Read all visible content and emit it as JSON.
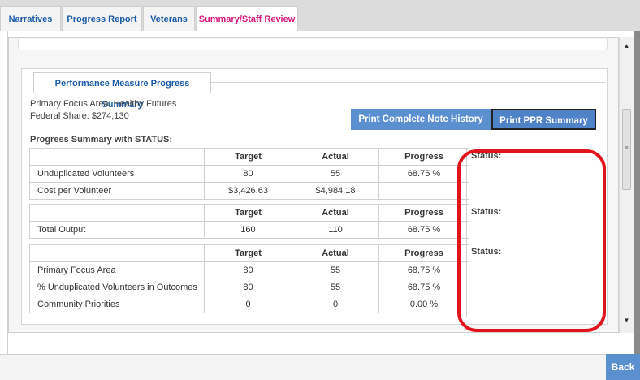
{
  "tabs": [
    {
      "label": "Narratives",
      "active": false
    },
    {
      "label": "Progress Report",
      "active": false
    },
    {
      "label": "Veterans",
      "active": false
    },
    {
      "label": "Summary/Staff Review",
      "active": true
    }
  ],
  "section": {
    "title": "Performance Measure Progress Summary",
    "primary_focus": "Primary Focus Area: Healthy Futures",
    "federal_share": "Federal Share: $274,130",
    "subheading": "Progress Summary with STATUS:"
  },
  "buttons": {
    "print_history": "Print Complete Note History",
    "print_summary": "Print PPR Summary",
    "back": "Back"
  },
  "tables": [
    {
      "headers": [
        "",
        "Target",
        "Actual",
        "Progress"
      ],
      "rows": [
        [
          "Unduplicated Volunteers",
          "80",
          "55",
          "68.75 %"
        ],
        [
          "Cost per Volunteer",
          "$3,426.63",
          "$4,984.18",
          ""
        ]
      ],
      "status_label": "Status:"
    },
    {
      "headers": [
        "",
        "Target",
        "Actual",
        "Progress"
      ],
      "rows": [
        [
          "Total Output",
          "160",
          "110",
          "68.75 %"
        ]
      ],
      "status_label": "Status:"
    },
    {
      "headers": [
        "",
        "Target",
        "Actual",
        "Progress"
      ],
      "rows": [
        [
          "Primary Focus Area",
          "80",
          "55",
          "68.75 %"
        ],
        [
          "% Unduplicated Volunteers in Outcomes",
          "80",
          "55",
          "68.75 %"
        ],
        [
          "Community Priorities",
          "0",
          "0",
          "0.00 %"
        ]
      ],
      "status_label": "Status:"
    }
  ],
  "scrollbar": {
    "up_icon": "triangle-up",
    "down_icon": "triangle-down",
    "grip_icon": "grip-lines"
  },
  "colors": {
    "tab_text": "#1a5ca8",
    "active_tab": "#d9177a",
    "button": "#5a8fd0",
    "highlight": "#e2141b"
  }
}
